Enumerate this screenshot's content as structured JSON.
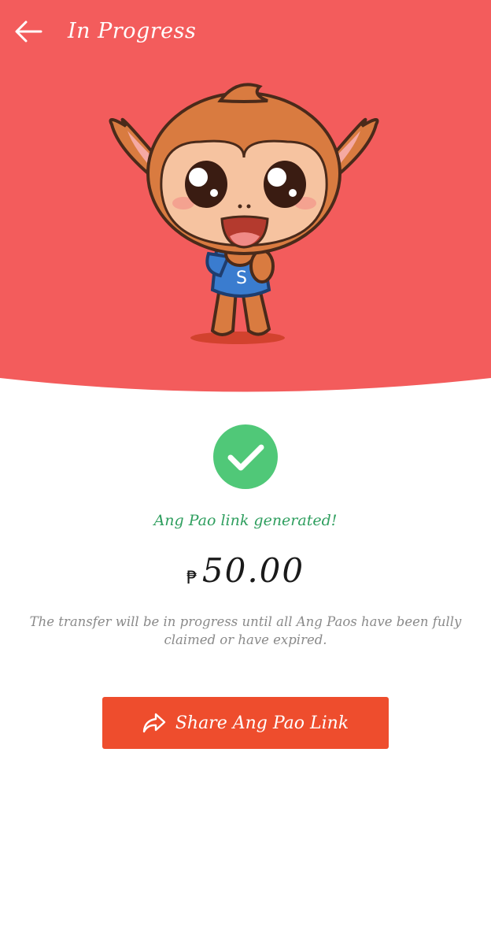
{
  "header": {
    "title": "In Progress",
    "back_icon": "arrow-left-icon",
    "background_color": "#f35c5c"
  },
  "hero": {
    "mascot_icon": "monkey-mascot-illustration",
    "mascot_shirt_letter": "S"
  },
  "status": {
    "icon": "check-circle-icon",
    "icon_color": "#50c878",
    "message": "Ang Pao link generated!",
    "message_color": "#2e9e5e"
  },
  "amount": {
    "currency_symbol": "₱",
    "value": "50.00"
  },
  "note": "The transfer will be in progress until all Ang Paos have been fully claimed or have expired.",
  "share_button": {
    "label": "Share Ang Pao Link",
    "icon": "share-arrow-icon",
    "color": "#ee4d2d"
  }
}
